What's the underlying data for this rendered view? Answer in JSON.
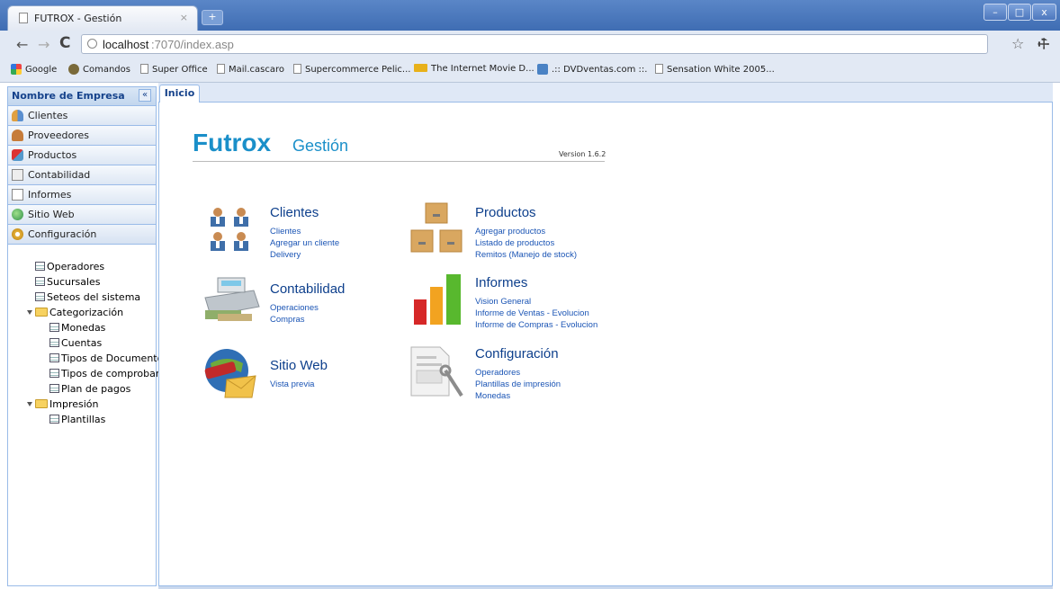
{
  "browser": {
    "tab_title": "FUTROX - Gestión",
    "tab_close": "×",
    "new_tab": "+",
    "url_host": "localhost",
    "url_rest": ":7070/index.asp",
    "window_buttons": [
      "–",
      "□",
      "x"
    ]
  },
  "bookmarks": [
    {
      "label": "Google",
      "icon": "google-icon"
    },
    {
      "label": "Comandos",
      "icon": "person-icon"
    },
    {
      "label": "Super Office",
      "icon": "page-icon"
    },
    {
      "label": "Mail.cascaro",
      "icon": "page-icon"
    },
    {
      "label": "Supercommerce Pelic...",
      "icon": "page-icon"
    },
    {
      "label": "The Internet Movie D...",
      "icon": "imdb-icon"
    },
    {
      "label": ".:: DVDventas.com ::.",
      "icon": "dvd-icon"
    },
    {
      "label": "Sensation White 2005...",
      "icon": "page-icon"
    }
  ],
  "sidebar": {
    "title": "Nombre de Empresa",
    "collapse": "«",
    "items": [
      {
        "label": "Clientes",
        "icon": "clients-icon"
      },
      {
        "label": "Proveedores",
        "icon": "provider-icon"
      },
      {
        "label": "Productos",
        "icon": "products-icon"
      },
      {
        "label": "Contabilidad",
        "icon": "calculator-icon"
      },
      {
        "label": "Informes",
        "icon": "report-icon"
      },
      {
        "label": "Sitio Web",
        "icon": "globe-icon"
      },
      {
        "label": "Configuración",
        "icon": "gear-icon"
      }
    ],
    "tree": [
      {
        "label": "Operadores",
        "type": "leaf",
        "level": 1
      },
      {
        "label": "Sucursales",
        "type": "leaf",
        "level": 1
      },
      {
        "label": "Seteos del sistema",
        "type": "leaf",
        "level": 1
      },
      {
        "label": "Categorización",
        "type": "folder",
        "level": 1
      },
      {
        "label": "Monedas",
        "type": "leaf",
        "level": 2
      },
      {
        "label": "Cuentas",
        "type": "leaf",
        "level": 2
      },
      {
        "label": "Tipos de Documentos",
        "type": "leaf",
        "level": 2
      },
      {
        "label": "Tipos de comprobante",
        "type": "leaf",
        "level": 2
      },
      {
        "label": "Plan de pagos",
        "type": "leaf",
        "level": 2
      },
      {
        "label": "Impresión",
        "type": "folder",
        "level": 1
      },
      {
        "label": "Plantillas",
        "type": "leaf",
        "level": 2
      }
    ]
  },
  "main": {
    "tab": "Inicio",
    "logo_main": "Futrox",
    "logo_sub": "Gestión",
    "version": "Version 1.6.2",
    "sections": [
      {
        "title": "Clientes",
        "icon": "clients-icon",
        "links": [
          "Clientes",
          "Agregar un cliente",
          "Delivery"
        ]
      },
      {
        "title": "Productos",
        "icon": "boxes-icon",
        "links": [
          "Agregar productos",
          "Listado de productos",
          "Remitos (Manejo de stock)"
        ]
      },
      {
        "title": "Contabilidad",
        "icon": "cash-register-icon",
        "links": [
          "Operaciones",
          "Compras"
        ]
      },
      {
        "title": "Informes",
        "icon": "bar-chart-icon",
        "links": [
          "Vision General",
          "Informe de Ventas - Evolucion",
          "Informe de Compras - Evolucion"
        ]
      },
      {
        "title": "Sitio Web",
        "icon": "www-globe-icon",
        "links": [
          "Vista previa"
        ]
      },
      {
        "title": "Configuración",
        "icon": "config-document-icon",
        "links": [
          "Operadores",
          "Plantillas de impresión",
          "Monedas"
        ]
      }
    ]
  }
}
